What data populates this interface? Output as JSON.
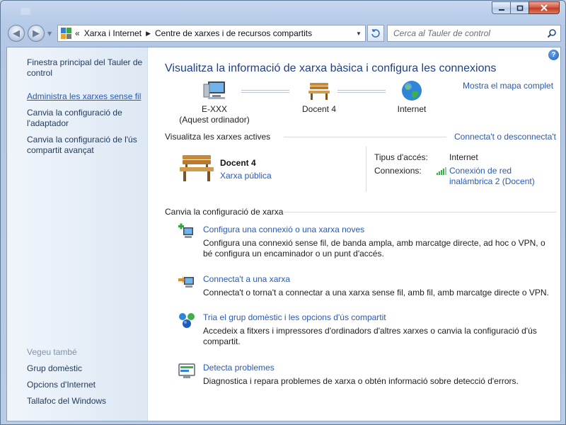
{
  "window": {
    "caption_buttons": {
      "minimize": "minimize",
      "maximize": "maximize",
      "close": "close"
    }
  },
  "address_bar": {
    "overflow": "«",
    "crumbs": [
      "Xarxa i Internet",
      "Centre de xarxes i de recursos compartits"
    ],
    "separator": "▶"
  },
  "search": {
    "placeholder": "Cerca al Tauler de control"
  },
  "sidebar": {
    "items": [
      "Finestra principal del Tauler de control",
      "Administra les xarxes sense fil",
      "Canvia la configuració de l'adaptador",
      "Canvia la configuració de l'ús compartit avançat"
    ],
    "see_also_heading": "Vegeu també",
    "see_also": [
      "Grup domèstic",
      "Opcions d'Internet",
      "Tallafoc del Windows"
    ]
  },
  "main": {
    "title": "Visualitza la informació de xarxa bàsica i configura les connexions",
    "full_map_link": "Mostra el mapa complet",
    "map": {
      "computer_name": "E-XXX",
      "computer_sub": "(Aquest ordinador)",
      "network_name": "Docent  4",
      "internet": "Internet"
    },
    "active_networks": {
      "heading": "Visualitza les xarxes actives",
      "connect_link": "Connecta't o desconnecta't",
      "network_name": "Docent  4",
      "network_type": "Xarxa pública",
      "access_type_label": "Tipus d'accés:",
      "access_type_value": "Internet",
      "connections_label": "Connexions:",
      "connection_line1": "Conexión de red",
      "connection_line2": "inalámbrica 2 (Docent)"
    },
    "change_settings": {
      "heading": "Canvia la configuració de xarxa",
      "tasks": [
        {
          "link": "Configura una connexió o una xarxa noves",
          "desc": "Configura una connexió sense fil, de banda ampla, amb marcatge directe, ad hoc o VPN, o bé configura un encaminador o un punt d'accés."
        },
        {
          "link": "Connecta't a una xarxa",
          "desc": "Connecta't o torna't a connectar a una xarxa sense fil, amb fil, amb marcatge directe o VPN."
        },
        {
          "link": "Tria el grup domèstic i les opcions d'ús compartit",
          "desc": "Accedeix a fitxers i impressores d'ordinadors d'altres xarxes o canvia la configuració d'ús compartit."
        },
        {
          "link": "Detecta problemes",
          "desc": "Diagnostica i repara problemes de xarxa o obtén informació sobre detecció d'errors."
        }
      ]
    }
  },
  "colors": {
    "link": "#2a59b4",
    "title": "#1e3f88",
    "sidebar_text": "#1e395b"
  }
}
